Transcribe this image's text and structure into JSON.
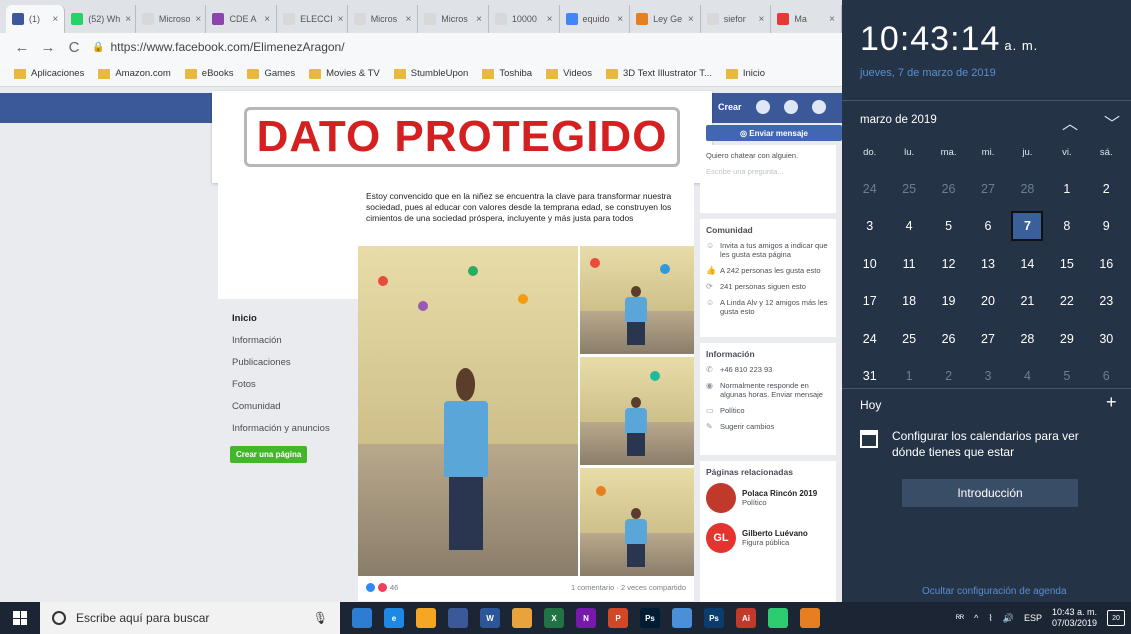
{
  "browser": {
    "tabs": [
      {
        "label": "(1) ",
        "color": "#3b5998",
        "active": true
      },
      {
        "label": "(52) Wh",
        "color": "#25d366"
      },
      {
        "label": "Microso",
        "color": "#d8d8d8"
      },
      {
        "label": "CDE A",
        "color": "#8e44ad"
      },
      {
        "label": "ELECCI",
        "color": "#d8d8d8"
      },
      {
        "label": "Micros",
        "color": "#d8d8d8"
      },
      {
        "label": "Micros",
        "color": "#d8d8d8"
      },
      {
        "label": "10000",
        "color": "#d8d8d8"
      },
      {
        "label": "equido",
        "color": "#4285f4"
      },
      {
        "label": "Ley Ge",
        "color": "#e67e22"
      },
      {
        "label": "siefor",
        "color": "#d8d8d8"
      },
      {
        "label": "Ma",
        "color": "#e53935"
      }
    ],
    "url": "https://www.facebook.com/ElimenezAragon/",
    "bookmarks": [
      "Aplicaciones",
      "Amazon.com",
      "eBooks",
      "Games",
      "Movies & TV",
      "StumbleUpon",
      "Toshiba",
      "Videos",
      "3D Text Illustrator T...",
      "Inicio"
    ]
  },
  "facebook": {
    "topbar_create": "Crear",
    "protected_banner": "DATO PROTEGIDO",
    "send_message": "Enviar mensaje",
    "sidenav": [
      "Inicio",
      "Información",
      "Publicaciones",
      "Fotos",
      "Comunidad",
      "Información y anuncios"
    ],
    "create_page": "Crear una página",
    "post_text": "Estoy convencido que en la niñez se encuentra la clave para transformar nuestra sociedad, pues al educar con valores desde la temprana edad, se construyen los cimientos de una sociedad próspera, incluyente y más justa para todos",
    "reaction_count": "46",
    "comments_shares": "1 comentario · 2 veces compartido",
    "faq": [
      "Quiero chatear con alguien.",
      "Escribe una pregunta..."
    ],
    "community": {
      "title": "Comunidad",
      "items": [
        "Invita a tus amigos a indicar que les gusta esta página",
        "A 242 personas les gusta esto",
        "241 personas siguen esto",
        "A Linda Alv y 12 amigos más les gusta esto"
      ]
    },
    "info": {
      "title": "Información",
      "phone": "+46 810 223 93",
      "response": "Normalmente responde en algunas horas. Enviar mensaje",
      "category": "Político",
      "suggest": "Sugerir cambios"
    },
    "related": {
      "title": "Páginas relacionadas",
      "pages": [
        {
          "name": "Polaca Rincón 2019",
          "category": "Político",
          "logo": "#c0392b",
          "initials": ""
        },
        {
          "name": "Gilberto Luévano",
          "category": "Figura pública",
          "logo": "#e3342f",
          "initials": "GL"
        }
      ]
    }
  },
  "calendar": {
    "time": "10:43:14",
    "ampm": "a. m.",
    "long_date": "jueves, 7 de marzo de 2019",
    "month_label": "marzo de 2019",
    "weekdays": [
      "do.",
      "lu.",
      "ma.",
      "mi.",
      "ju.",
      "vi.",
      "sá."
    ],
    "days": [
      {
        "d": "24",
        "other": true
      },
      {
        "d": "25",
        "other": true
      },
      {
        "d": "26",
        "other": true
      },
      {
        "d": "27",
        "other": true
      },
      {
        "d": "28",
        "other": true
      },
      {
        "d": "1"
      },
      {
        "d": "2"
      },
      {
        "d": "3"
      },
      {
        "d": "4"
      },
      {
        "d": "5"
      },
      {
        "d": "6"
      },
      {
        "d": "7",
        "today": true
      },
      {
        "d": "8"
      },
      {
        "d": "9"
      },
      {
        "d": "10"
      },
      {
        "d": "11"
      },
      {
        "d": "12"
      },
      {
        "d": "13"
      },
      {
        "d": "14"
      },
      {
        "d": "15"
      },
      {
        "d": "16"
      },
      {
        "d": "17"
      },
      {
        "d": "18"
      },
      {
        "d": "19"
      },
      {
        "d": "20"
      },
      {
        "d": "21"
      },
      {
        "d": "22"
      },
      {
        "d": "23"
      },
      {
        "d": "24"
      },
      {
        "d": "25"
      },
      {
        "d": "26"
      },
      {
        "d": "27"
      },
      {
        "d": "28"
      },
      {
        "d": "29"
      },
      {
        "d": "30"
      },
      {
        "d": "31"
      },
      {
        "d": "1",
        "other": true
      },
      {
        "d": "2",
        "other": true
      },
      {
        "d": "3",
        "other": true
      },
      {
        "d": "4",
        "other": true
      },
      {
        "d": "5",
        "other": true
      },
      {
        "d": "6",
        "other": true
      }
    ],
    "today_label": "Hoy",
    "configure_text": "Configurar los calendarios para ver dónde tienes que estar",
    "intro_button": "Introducción",
    "hide_agenda": "Ocultar configuración de agenda"
  },
  "taskbar": {
    "search_placeholder": "Escribe aquí para buscar",
    "apps": [
      {
        "label": "",
        "color": "#2d7dd2"
      },
      {
        "label": "e",
        "color": "#1e88e5"
      },
      {
        "label": "",
        "color": "#f5a623"
      },
      {
        "label": "",
        "color": "#3b5998"
      },
      {
        "label": "W",
        "color": "#2b579a"
      },
      {
        "label": "",
        "color": "#e8a33d"
      },
      {
        "label": "X",
        "color": "#217346"
      },
      {
        "label": "N",
        "color": "#7719aa"
      },
      {
        "label": "P",
        "color": "#d24726"
      },
      {
        "label": "Ps",
        "color": "#001d34"
      },
      {
        "label": "",
        "color": "#4a90d9"
      },
      {
        "label": "Ps",
        "color": "#0a3c6e"
      },
      {
        "label": "Ai",
        "color": "#c0392b"
      },
      {
        "label": "",
        "color": "#2ecc71"
      },
      {
        "label": "",
        "color": "#e67e22"
      }
    ],
    "lang": "ESP",
    "time": "10:43 a. m.",
    "date": "07/03/2019",
    "notif_count": "20"
  }
}
